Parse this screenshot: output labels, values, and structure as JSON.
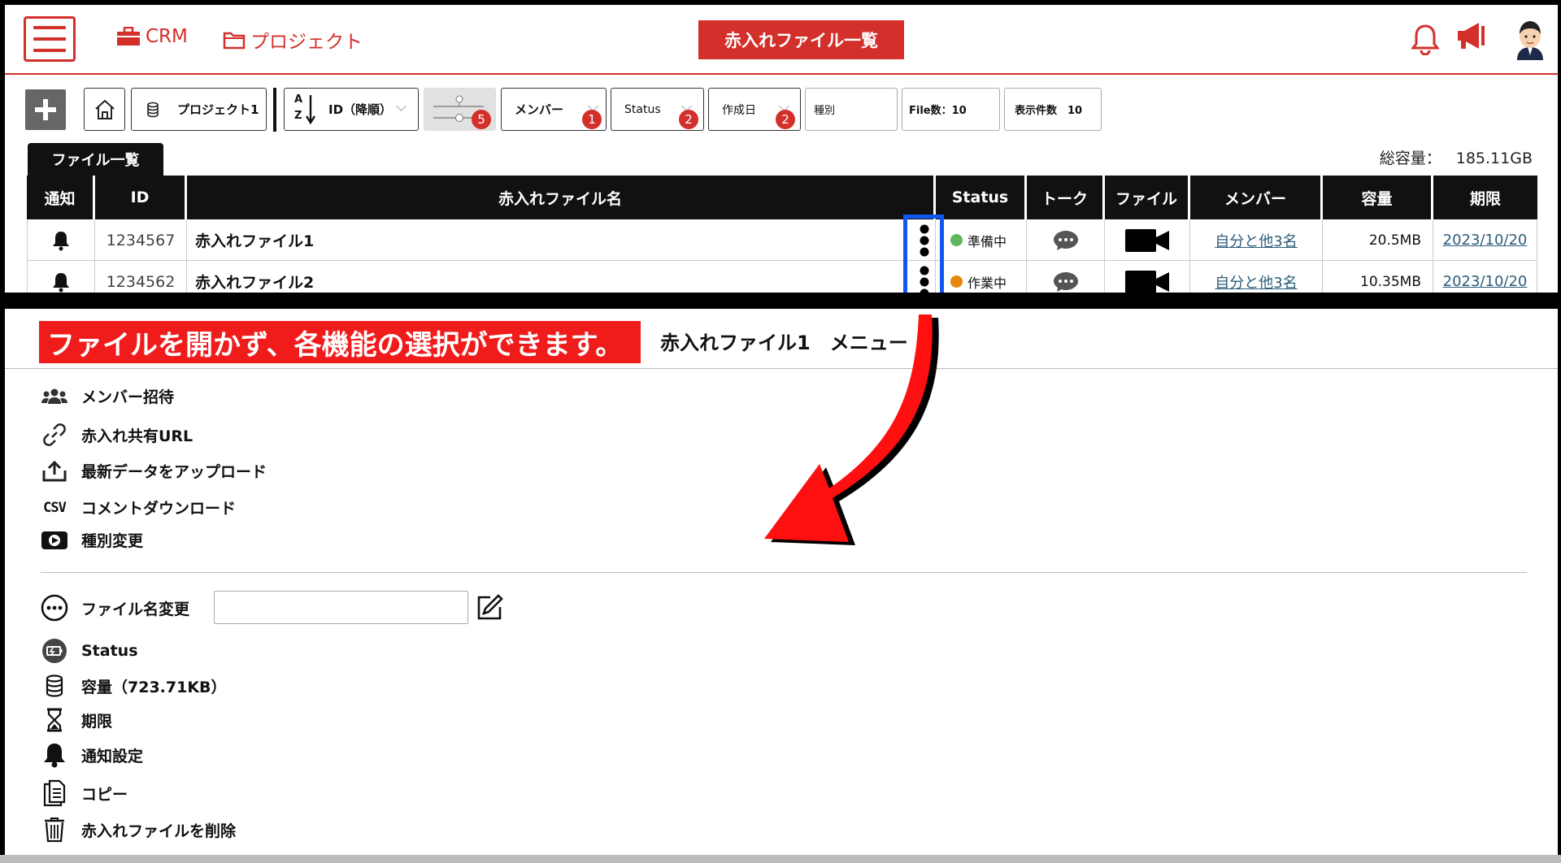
{
  "header": {
    "crm_label": "CRM",
    "project_label": "プロジェクト",
    "page_title": "赤入れファイル一覧"
  },
  "toolbar": {
    "add_label": "+",
    "project_selector": "プロジェクト1",
    "sort_label": "ID（降順）",
    "sort_az": "A",
    "sort_z": "Z",
    "filter_count": "5",
    "member_label": "メンバー",
    "member_count": "1",
    "status_label": "Status",
    "status_count": "2",
    "created_label": "作成日",
    "created_count": "2",
    "type_label": "種別",
    "file_count_label": "File数：10",
    "display_count_label": "表示件数　10"
  },
  "file_list": {
    "tab_label": "ファイル一覧",
    "total_label": "総容量：",
    "total_value": "185.11GB",
    "columns": [
      "通知",
      "ID",
      "赤入れファイル名",
      "Status",
      "トーク",
      "ファイル",
      "メンバー",
      "容量",
      "期限"
    ],
    "rows": [
      {
        "id": "1234567",
        "name": "赤入れファイル1",
        "status": "準備中",
        "status_color": "#5cb85c",
        "member": "自分と他3名",
        "size": "20.5MB",
        "deadline": "2023/10/20"
      },
      {
        "id": "1234562",
        "name": "赤入れファイル2",
        "status": "作業中",
        "status_color": "#e6860b",
        "member": "自分と他3名",
        "size": "10.35MB",
        "deadline": "2023/10/20"
      }
    ]
  },
  "callout": {
    "text": "ファイルを開かず、各機能の選択ができます。",
    "menu_title": "赤入れファイル1　メニュー"
  },
  "menu": {
    "invite": "メンバー招待",
    "share_url": "赤入れ共有URL",
    "upload": "最新データをアップロード",
    "csv_icon_text": "CSV",
    "comment_download": "コメントダウンロード",
    "type_change": "種別変更",
    "rename": "ファイル名変更",
    "status": "Status",
    "capacity": "容量（723.71KB）",
    "deadline": "期限",
    "notify": "通知設定",
    "copy": "コピー",
    "delete": "赤入れファイルを削除"
  },
  "colors": {
    "brand_red": "#d3302b",
    "callout_red": "#f01b1b",
    "highlight_blue": "#0f57f5"
  }
}
